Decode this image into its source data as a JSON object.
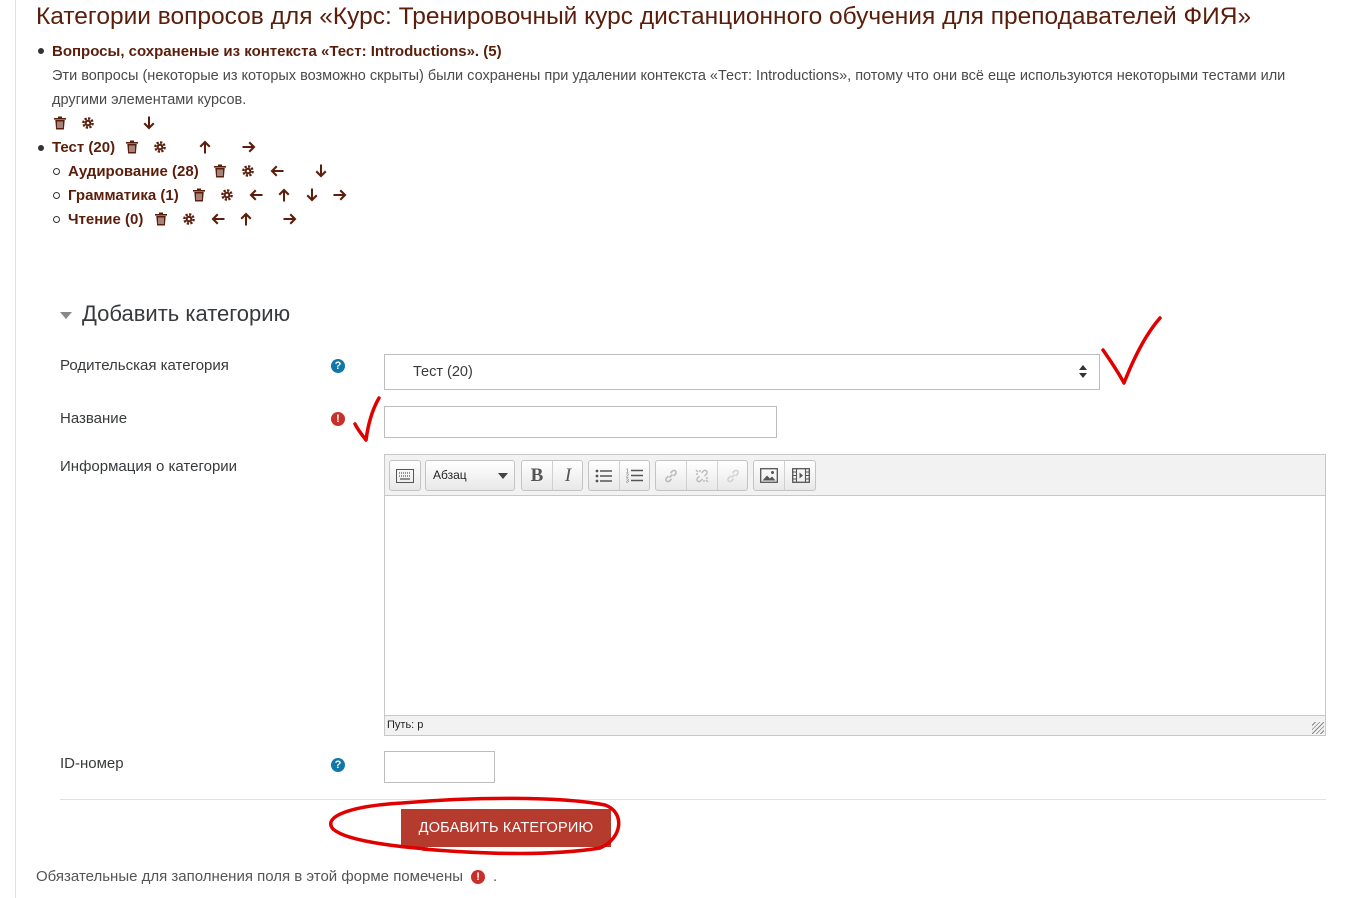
{
  "page": {
    "title": "Категории вопросов для «Курс: Тренировочный курс дистанционного обучения для преподавателей ФИЯ»"
  },
  "categories": [
    {
      "name": "Вопросы, сохраненые из контекста «Тест: Introductions». (5)",
      "description": "Эти вопросы (некоторые из которых возможно скрыты) были сохранены при удалении контекста «Тест: Introductions», потому что они всё еще используются некоторыми тестами или другими элементами курсов.",
      "actions": [
        "delete-icon",
        "gear-icon",
        "arrow-down-icon"
      ]
    },
    {
      "name": "Тест (20)",
      "actions": [
        "delete-icon",
        "gear-icon",
        "arrow-up-icon",
        "arrow-right-icon"
      ],
      "children": [
        {
          "name": "Аудирование (28)",
          "actions": [
            "delete-icon",
            "gear-icon",
            "arrow-left-icon",
            "arrow-down-icon"
          ]
        },
        {
          "name": "Грамматика (1)",
          "actions": [
            "delete-icon",
            "gear-icon",
            "arrow-left-icon",
            "arrow-up-icon",
            "arrow-down-icon",
            "arrow-right-icon"
          ]
        },
        {
          "name": "Чтение (0)",
          "actions": [
            "delete-icon",
            "gear-icon",
            "arrow-left-icon",
            "arrow-up-icon",
            "arrow-right-icon"
          ]
        }
      ]
    }
  ],
  "form": {
    "legend": "Добавить категорию",
    "parent_label": "Родительская категория",
    "parent_value": "Тест (20)",
    "name_label": "Название",
    "info_label": "Информация о категории",
    "editor": {
      "format_value": "Абзац",
      "bold": "B",
      "italic": "I",
      "path": "Путь: p"
    },
    "idnumber_label": "ID-номер",
    "submit_label": "ДОБАВИТЬ КАТЕГОРИЮ"
  },
  "footer": {
    "required_note": "Обязательные для заполнения поля в этой форме помечены",
    "required_note_end": "."
  },
  "colors": {
    "link": "#5a1e0b",
    "primary_button": "#b43b2d",
    "help_icon": "#1177a8",
    "required_icon": "#c9302c",
    "annotation": "#e00000"
  }
}
